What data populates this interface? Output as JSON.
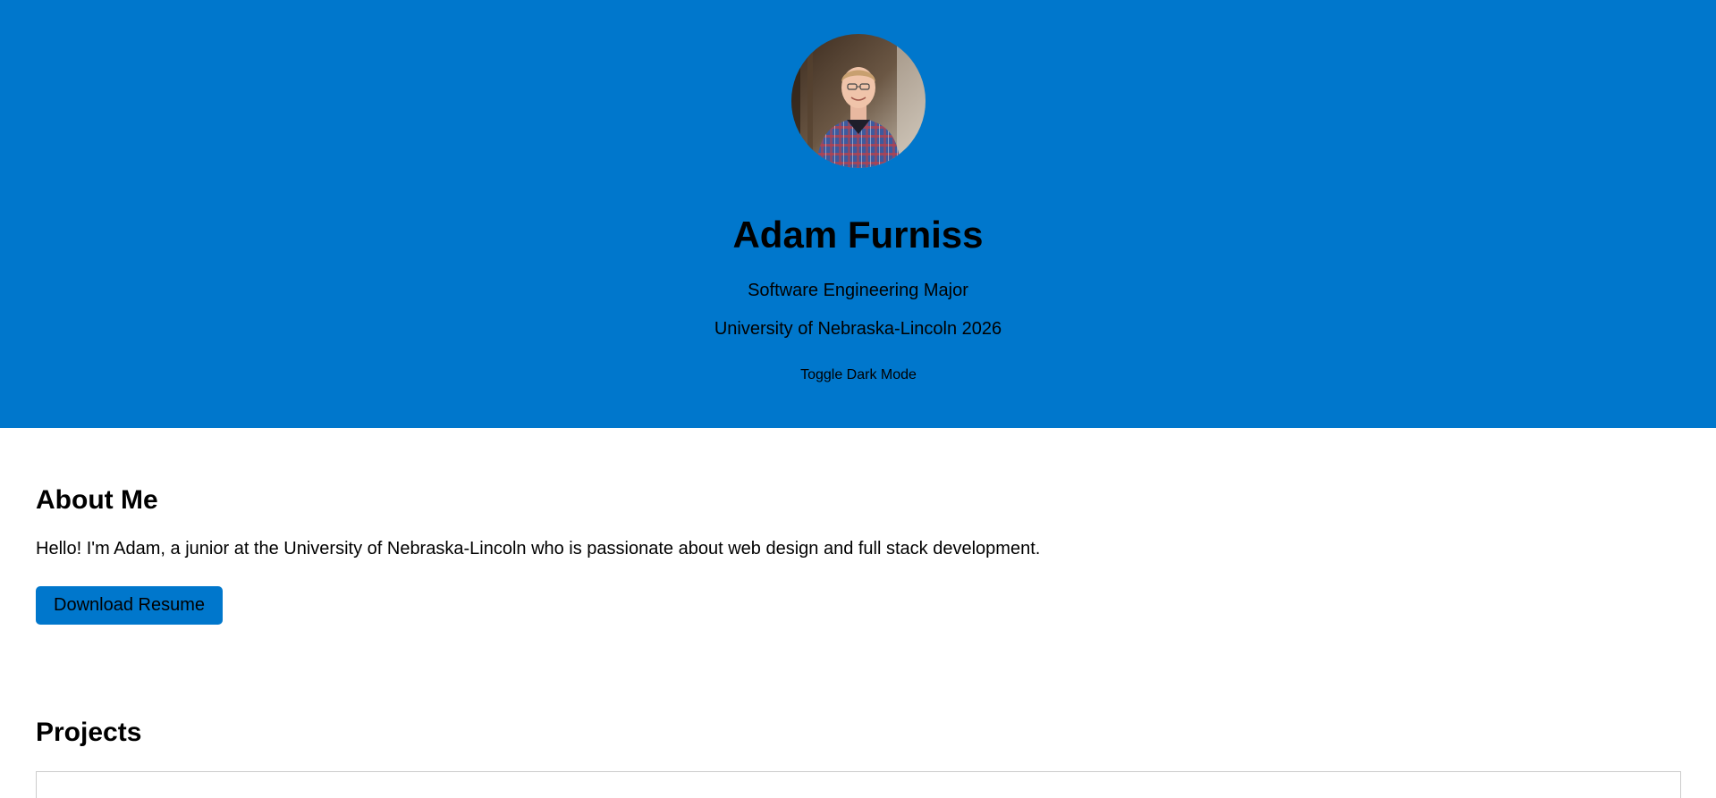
{
  "hero": {
    "name": "Adam Furniss",
    "major": "Software Engineering Major",
    "school": "University of Nebraska-Lincoln 2026",
    "toggle_label": "Toggle Dark Mode",
    "avatar_alt": "Adam Furniss",
    "background_color": "#0077cc"
  },
  "about": {
    "title": "About Me",
    "text": "Hello! I'm Adam, a junior at the University of Nebraska-Lincoln who is passionate about web design and full stack development.",
    "resume_label": "Download Resume",
    "button_color": "#0077cc"
  },
  "projects": {
    "title": "Projects"
  }
}
